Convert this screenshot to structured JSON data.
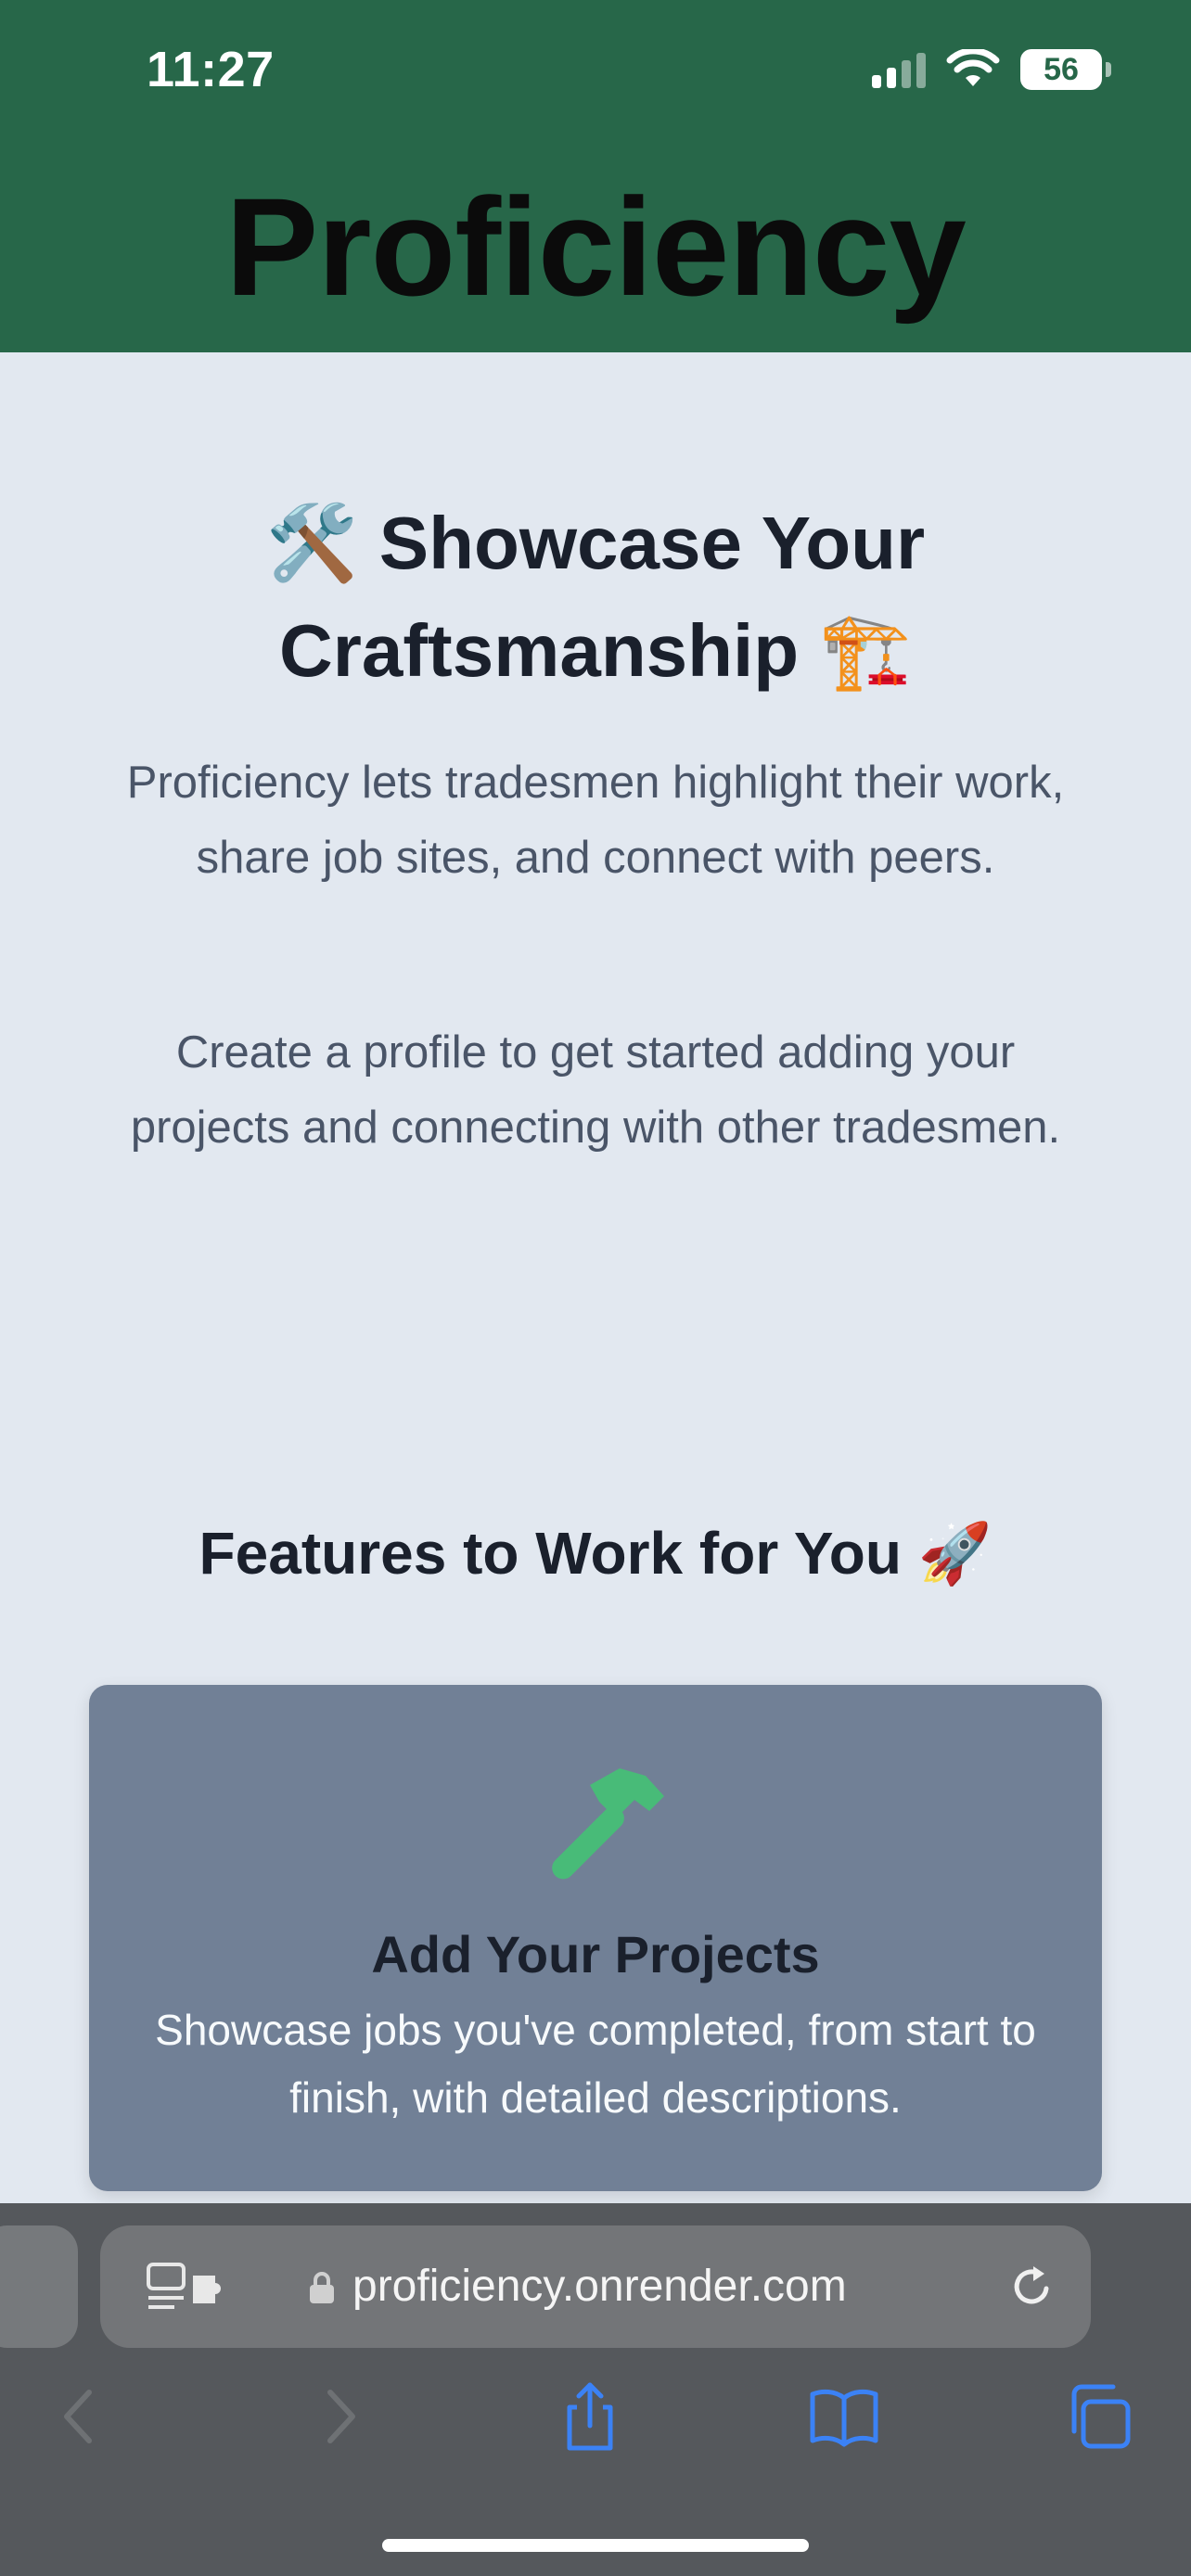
{
  "status_bar": {
    "time": "11:27",
    "battery": "56",
    "icons": [
      "signal-icon",
      "wifi-icon",
      "battery-icon"
    ]
  },
  "header": {
    "title": "Proficiency"
  },
  "hero": {
    "title_line1": "Showcase Your",
    "title_line2": "Craftsmanship",
    "emoji_start": "🛠️",
    "emoji_end": "🏗️",
    "description": "Proficiency lets tradesmen highlight their work, share job sites, and connect with peers.",
    "cta_text": "Create a profile to get started adding your projects and connecting with other tradesmen."
  },
  "features": {
    "title": "Features to Work for You",
    "emoji": "🚀",
    "cards": [
      {
        "icon": "hammer-icon",
        "title": "Add Your Projects",
        "description": "Showcase jobs you've completed, from start to finish, with detailed descriptions."
      }
    ]
  },
  "browser": {
    "url": "proficiency.onrender.com",
    "toolbar_icons": [
      "back-icon",
      "forward-icon",
      "share-icon",
      "bookmarks-icon",
      "tabs-icon"
    ]
  },
  "colors": {
    "header_bg": "#276749",
    "page_bg": "#e2e8f0",
    "card_bg": "#718096",
    "accent_green": "#48bb78",
    "browser_bg": "#55585c",
    "browser_blue": "#3b82f6"
  }
}
